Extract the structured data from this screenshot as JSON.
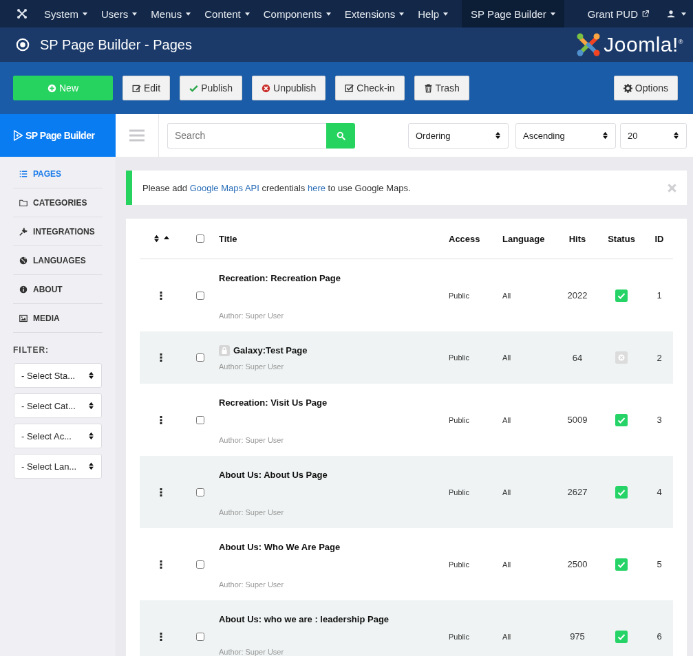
{
  "top_menu": {
    "items": [
      {
        "label": "System",
        "dropdown": true,
        "selected": false
      },
      {
        "label": "Users",
        "dropdown": true,
        "selected": false
      },
      {
        "label": "Menus",
        "dropdown": true,
        "selected": false
      },
      {
        "label": "Content",
        "dropdown": true,
        "selected": false
      },
      {
        "label": "Components",
        "dropdown": true,
        "selected": false
      },
      {
        "label": "Extensions",
        "dropdown": true,
        "selected": false
      },
      {
        "label": "Help",
        "dropdown": true,
        "selected": false
      },
      {
        "label": "SP Page Builder",
        "dropdown": true,
        "selected": true
      }
    ],
    "site_link": "Grant PUD"
  },
  "header": {
    "title": "SP Page Builder - Pages",
    "logo_text": "Joomla!$^{®}$"
  },
  "toolbar": {
    "buttons": [
      {
        "label": "New",
        "kind": "new"
      },
      {
        "label": "Edit",
        "kind": "edit"
      },
      {
        "label": "Publish",
        "kind": "publish"
      },
      {
        "label": "Unpublish",
        "kind": "unpublish"
      },
      {
        "label": "Check-in",
        "kind": "checkin"
      },
      {
        "label": "Trash",
        "kind": "trash"
      },
      {
        "label": "Options",
        "kind": "options"
      }
    ]
  },
  "sidebar": {
    "brand": "SP Page Builder",
    "items": [
      {
        "label": "PAGES",
        "kind": "pages",
        "selected": true
      },
      {
        "label": "CATEGORIES",
        "kind": "categories",
        "selected": false
      },
      {
        "label": "INTEGRATIONS",
        "kind": "integrations",
        "selected": false
      },
      {
        "label": "LANGUAGES",
        "kind": "languages",
        "selected": false
      },
      {
        "label": "ABOUT",
        "kind": "about",
        "selected": false
      },
      {
        "label": "MEDIA",
        "kind": "media",
        "selected": false
      }
    ],
    "filter_label": "FILTER:",
    "filters": [
      "- Select Sta...",
      "- Select Cat...",
      "- Select Ac...",
      "- Select Lan..."
    ]
  },
  "list_bar": {
    "search": {
      "placeholder": "Search"
    },
    "ordering": "Ordering",
    "direction": "Ascending",
    "limit": "20"
  },
  "alert": {
    "parts": [
      {
        "text": "Please add ",
        "link": false
      },
      {
        "text": "Google Maps API",
        "link": true
      },
      {
        "text": " credentials ",
        "link": false
      },
      {
        "text": "here",
        "link": true
      },
      {
        "text": " to use Google Maps.",
        "link": false
      }
    ]
  },
  "table": {
    "select_all": {
      "checked": false
    },
    "columns": [
      "Title",
      "Access",
      "Language",
      "Hits",
      "Status",
      "ID"
    ],
    "rows": [
      {
        "title": "Recreation: Recreation Page",
        "author": "Author: Super User",
        "access": "Public",
        "language": "All",
        "hits": "2022",
        "published": true,
        "id": "1",
        "checked_out": false,
        "checked": false
      },
      {
        "title": "Galaxy:Test Page",
        "author": "Author: Super User",
        "access": "Public",
        "language": "All",
        "hits": "64",
        "published": false,
        "id": "2",
        "checked_out": true,
        "checked": false
      },
      {
        "title": "Recreation: Visit Us Page",
        "author": "Author: Super User",
        "access": "Public",
        "language": "All",
        "hits": "5009",
        "published": true,
        "id": "3",
        "checked_out": false,
        "checked": false
      },
      {
        "title": "About Us: About Us Page",
        "author": "Author: Super User",
        "access": "Public",
        "language": "All",
        "hits": "2627",
        "published": true,
        "id": "4",
        "checked_out": false,
        "checked": false
      },
      {
        "title": "About Us: Who We Are Page",
        "author": "Author: Super User",
        "access": "Public",
        "language": "All",
        "hits": "2500",
        "published": true,
        "id": "5",
        "checked_out": false,
        "checked": false
      },
      {
        "title": "About Us: who we are : leadership Page",
        "author": "Author: Super User",
        "access": "Public",
        "language": "All",
        "hits": "975",
        "published": true,
        "id": "6",
        "checked_out": false,
        "checked": false
      }
    ]
  }
}
